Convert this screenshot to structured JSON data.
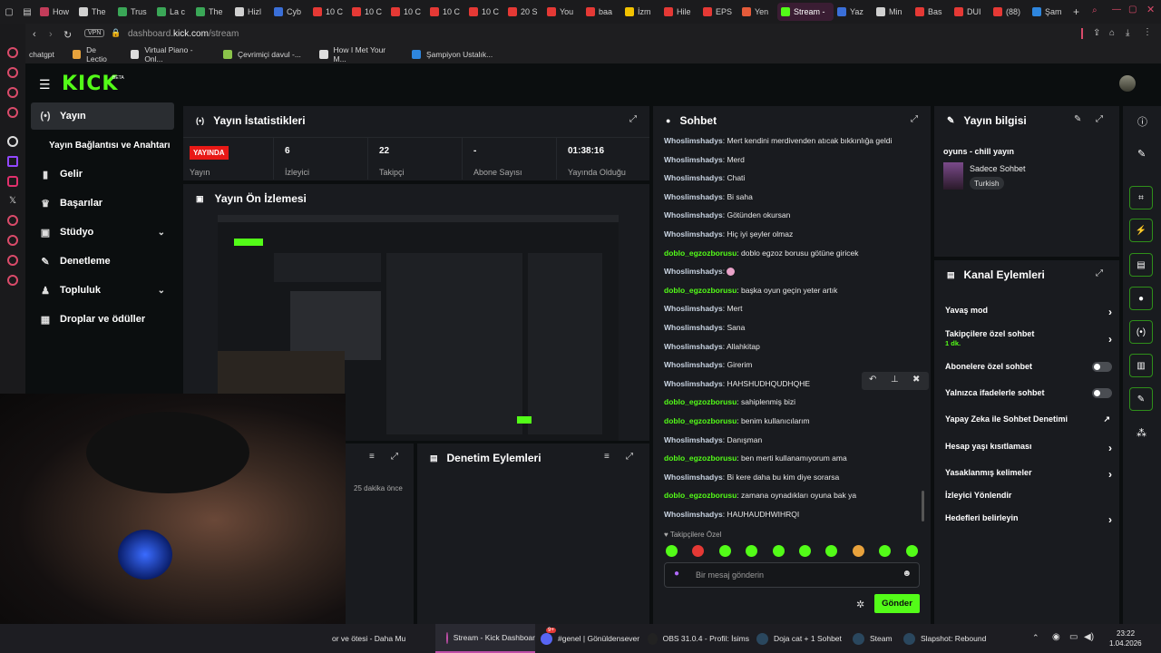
{
  "colors": {
    "accent": "#53fc18",
    "live": "#e91916",
    "bg": "#0b0e0f",
    "panel": "#191b1f"
  },
  "browser": {
    "tabs": [
      {
        "label": "How",
        "color": "#c23c5a"
      },
      {
        "label": "The",
        "color": "#d0d0d0"
      },
      {
        "label": "Trus",
        "color": "#3aa757"
      },
      {
        "label": "La c",
        "color": "#3aa757"
      },
      {
        "label": "The",
        "color": "#3aa757"
      },
      {
        "label": "Hizl",
        "color": "#d0d0d0"
      },
      {
        "label": "Cyb",
        "color": "#3a6fd8"
      },
      {
        "label": "10 C",
        "color": "#e53935"
      },
      {
        "label": "10 C",
        "color": "#e53935"
      },
      {
        "label": "10 C",
        "color": "#e53935"
      },
      {
        "label": "10 C",
        "color": "#e53935"
      },
      {
        "label": "10 C",
        "color": "#e53935"
      },
      {
        "label": "20 S",
        "color": "#e53935"
      },
      {
        "label": "You",
        "color": "#e53935"
      },
      {
        "label": "baa",
        "color": "#e53935"
      },
      {
        "label": "İzm",
        "color": "#f2c200"
      },
      {
        "label": "Hile",
        "color": "#e53935"
      },
      {
        "label": "EPS",
        "color": "#e53935"
      },
      {
        "label": "Yen",
        "color": "#e55b3a"
      },
      {
        "label": "Stream -",
        "color": "#53fc18",
        "active": true
      },
      {
        "label": "Yaz",
        "color": "#3a6fd8"
      },
      {
        "label": "Min",
        "color": "#d0d0d0"
      },
      {
        "label": "Bas",
        "color": "#e53935"
      },
      {
        "label": "DUI",
        "color": "#e53935"
      },
      {
        "label": "(88)",
        "color": "#e53935"
      },
      {
        "label": "Şam",
        "color": "#2e86de"
      }
    ],
    "url_prefix": "dashboard.",
    "url_host": "kick.com",
    "url_path": "/stream",
    "vpn": "VPN",
    "bookmarks": [
      "chatgpt",
      "De Lectio",
      "Virtual Piano - Onl...",
      "Çevrimiçi davul -...",
      "How I Met Your M...",
      "Şampiyon Ustalık..."
    ]
  },
  "brand": {
    "logo": "KICK",
    "beta": "BETA"
  },
  "sidebar": {
    "items": [
      {
        "label": "Yayın",
        "icon": "broadcast-icon"
      },
      {
        "label": "Yayın Bağlantısı ve Anahtarı",
        "icon": ""
      },
      {
        "label": "Gelir",
        "icon": "bar-chart-icon"
      },
      {
        "label": "Başarılar",
        "icon": "trophy-icon"
      },
      {
        "label": "Stüdyo",
        "icon": "studio-icon"
      },
      {
        "label": "Denetleme",
        "icon": "wrench-icon"
      },
      {
        "label": "Topluluk",
        "icon": "community-icon"
      },
      {
        "label": "Droplar ve ödüller",
        "icon": "gift-icon"
      }
    ]
  },
  "stats": {
    "title": "Yayın İstatistikleri",
    "live_badge": "YAYINDA",
    "live_label": "Yayın",
    "items": [
      {
        "value": "6",
        "label": "İzleyici"
      },
      {
        "value": "22",
        "label": "Takipçi"
      },
      {
        "value": "-",
        "label": "Abone Sayısı"
      },
      {
        "value": "01:38:16",
        "label": "Yayında Olduğu"
      }
    ]
  },
  "preview": {
    "title": "Yayın Ön İzlemesi"
  },
  "lower": {
    "timestamp": "25 dakika önce",
    "moderation_title": "Denetim Eylemleri"
  },
  "chat": {
    "title": "Sohbet",
    "messages": [
      {
        "user": "Whoslimshadys",
        "text": "Mert kendini merdivenden atıcak bıkkınlığa geldi",
        "u": "u1"
      },
      {
        "user": "Whoslimshadys",
        "text": "Merd",
        "u": "u1"
      },
      {
        "user": "Whoslimshadys",
        "text": "Chati",
        "u": "u1"
      },
      {
        "user": "Whoslimshadys",
        "text": "Bi saha",
        "u": "u1"
      },
      {
        "user": "Whoslimshadys",
        "text": "Götünden okursan",
        "u": "u1"
      },
      {
        "user": "Whoslimshadys",
        "text": "Hiç iyi şeyler olmaz",
        "u": "u1"
      },
      {
        "user": "doblo_egzozborusu",
        "text": "doblo egzoz borusu götüne giricek",
        "u": "u2"
      },
      {
        "user": "Whoslimshadys",
        "text": "",
        "u": "u1",
        "emote": true
      },
      {
        "user": "doblo_egzozborusu",
        "text": "başka oyun geçin yeter artık",
        "u": "u2"
      },
      {
        "user": "Whoslimshadys",
        "text": "Mert",
        "u": "u1"
      },
      {
        "user": "Whoslimshadys",
        "text": "Sana",
        "u": "u1"
      },
      {
        "user": "Whoslimshadys",
        "text": "Allahkitap",
        "u": "u1"
      },
      {
        "user": "Whoslimshadys",
        "text": "Girerim",
        "u": "u1"
      },
      {
        "user": "Whoslimshadys",
        "text": "HAHSHUDHQUDHQHE",
        "u": "u1"
      },
      {
        "user": "doblo_egzozborusu",
        "text": "sahiplenmiş bizi",
        "u": "u2"
      },
      {
        "user": "doblo_egzozborusu",
        "text": "benim kullanıcılarım",
        "u": "u2"
      },
      {
        "user": "Whoslimshadys",
        "text": "Danışman",
        "u": "u1"
      },
      {
        "user": "doblo_egzozborusu",
        "text": "ben merti kullanamıyorum ama",
        "u": "u2"
      },
      {
        "user": "Whoslimshadys",
        "text": "Bi kere daha bu kim diye sorarsa",
        "u": "u1"
      },
      {
        "user": "doblo_egzozborusu",
        "text": "zamana oynadıkları oyuna bak ya",
        "u": "u2"
      },
      {
        "user": "Whoslimshadys",
        "text": "HAUHAUDHWIHRQI",
        "u": "u1"
      }
    ],
    "followers_only": "Takipçilere Özel",
    "placeholder": "Bir mesaj gönderin",
    "send": "Gönder"
  },
  "info": {
    "title": "Yayın bilgisi",
    "stream_title": "oyuns - chill yayın",
    "category": "Sadece Sohbet",
    "language": "Turkish"
  },
  "channel_actions": {
    "title": "Kanal Eylemleri",
    "items": [
      {
        "label": "Yavaş mod",
        "control": "chevron"
      },
      {
        "label": "Takipçilere özel sohbet",
        "sub": "1 dk.",
        "control": "chevron"
      },
      {
        "label": "Abonelere özel sohbet",
        "control": "toggle"
      },
      {
        "label": "Yalnızca ifadelerle sohbet",
        "control": "toggle"
      },
      {
        "label": "Yapay Zeka ile Sohbet Denetimi",
        "control": "external"
      },
      {
        "label": "Hesap yaşı kısıtlaması",
        "control": "chevron"
      },
      {
        "label": "Yasaklanmış kelimeler",
        "control": "chevron"
      },
      {
        "label": "İzleyici Yönlendir",
        "control": "none"
      },
      {
        "label": "Hedefleri belirleyin",
        "control": "chevron"
      }
    ]
  },
  "taskbar": {
    "items": [
      {
        "label": "or ve ötesi - Daha Mu"
      },
      {
        "label": "Stream - Kick Dashboar"
      },
      {
        "label": "#genel | Gönüldensever",
        "badge": "9+"
      },
      {
        "label": "OBS 31.0.4 - Profil: İsims"
      },
      {
        "label": "Doja cat + 1 Sohbet"
      },
      {
        "label": "Steam"
      },
      {
        "label": "Slapshot: Rebound"
      }
    ],
    "time": "23:22",
    "date": "1.04.2026"
  }
}
